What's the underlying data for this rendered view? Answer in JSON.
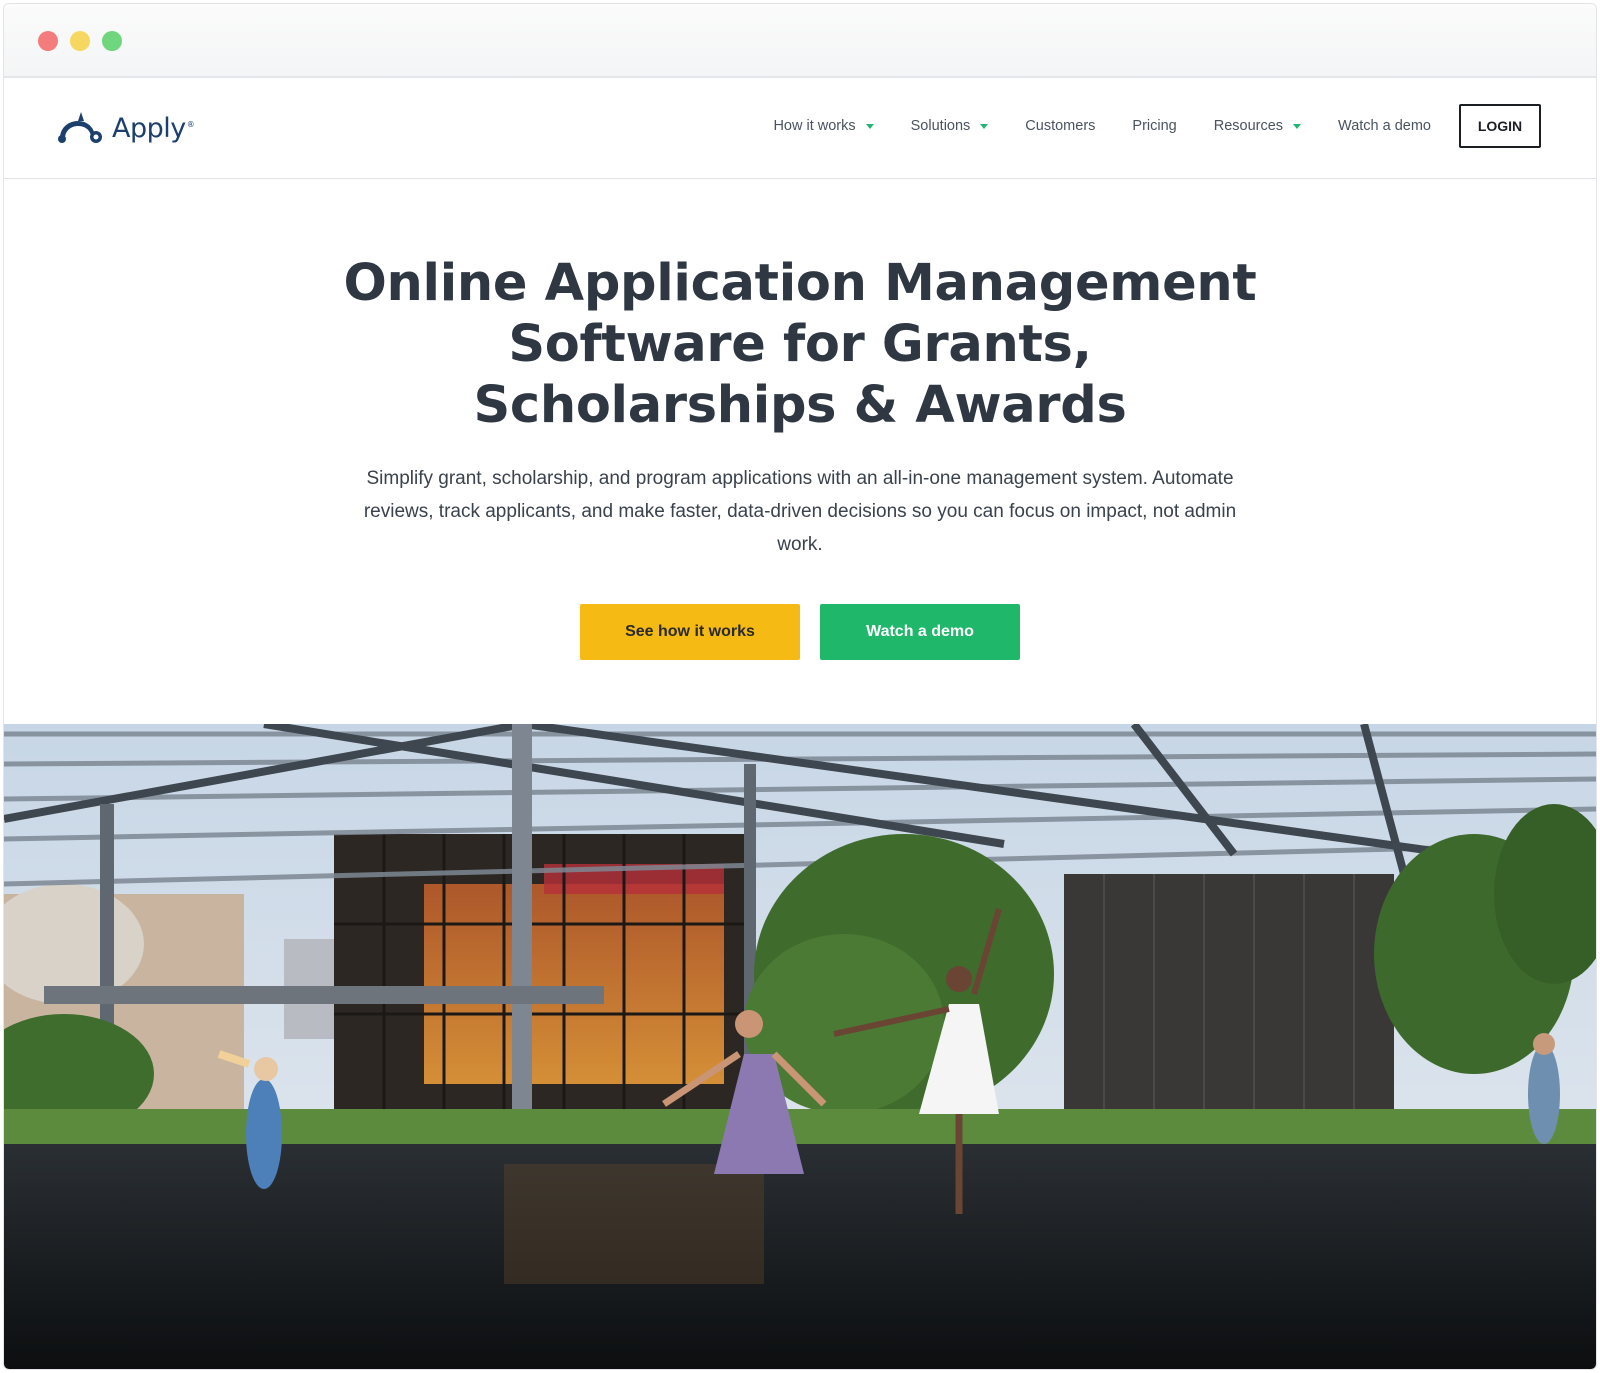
{
  "window": {
    "controls": [
      "close",
      "minimize",
      "maximize"
    ]
  },
  "brand": {
    "name": "Apply",
    "registered_mark": "®",
    "logo_icon": "beaver-icon",
    "color": "#1d3f6e"
  },
  "nav": {
    "items": [
      {
        "label": "How it works",
        "dropdown": true
      },
      {
        "label": "Solutions",
        "dropdown": true
      },
      {
        "label": "Customers",
        "dropdown": false
      },
      {
        "label": "Pricing",
        "dropdown": false
      },
      {
        "label": "Resources",
        "dropdown": true
      },
      {
        "label": "Watch a demo",
        "dropdown": false
      }
    ],
    "login_label": "LOGIN",
    "caret_color": "#22b573"
  },
  "hero": {
    "title": "Online Application Management Software for Grants, Scholarships & Awards",
    "subtitle": "Simplify grant, scholarship, and program applications with an all-in-one management system. Automate reviews, track applicants, and make faster, data-driven decisions so you can focus on impact, not admin work.",
    "primary_cta": "See how it works",
    "secondary_cta": "Watch a demo",
    "primary_color": "#f5ba14",
    "secondary_color": "#1fb86a"
  },
  "hero_image": {
    "icon": "photo-dancers-plaza"
  }
}
